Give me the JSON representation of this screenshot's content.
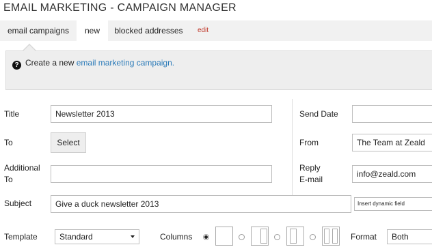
{
  "page_title": "EMAIL MARKETING - CAMPAIGN MANAGER",
  "tabs": [
    {
      "label": "email campaigns",
      "active": false
    },
    {
      "label": "new",
      "active": true
    },
    {
      "label": "blocked addresses",
      "active": false
    },
    {
      "label": "edit",
      "active": false
    }
  ],
  "info": {
    "prefix": "Create a new ",
    "link": "email marketing campaign.",
    "icon": "help-icon"
  },
  "form": {
    "title": {
      "label": "Title",
      "value": "Newsletter 2013"
    },
    "to": {
      "label": "To",
      "button": "Select"
    },
    "additional_to": {
      "label_line1": "Additional",
      "label_line2": "To",
      "value": ""
    },
    "subject": {
      "label": "Subject",
      "value": "Give a duck newsletter 2013",
      "dynamic_field": "Insert dynamic field"
    },
    "send_date": {
      "label": "Send Date",
      "value": ""
    },
    "from": {
      "label": "From",
      "value": "The Team at Zeald"
    },
    "reply_email": {
      "label_line1": "Reply",
      "label_line2": "E-mail",
      "value": "info@zeald.com"
    },
    "template": {
      "label": "Template",
      "value": "Standard"
    },
    "columns": {
      "label": "Columns",
      "selected": 1,
      "options": [
        1,
        2,
        3,
        4
      ]
    },
    "format": {
      "label": "Format",
      "value": "Both"
    }
  }
}
